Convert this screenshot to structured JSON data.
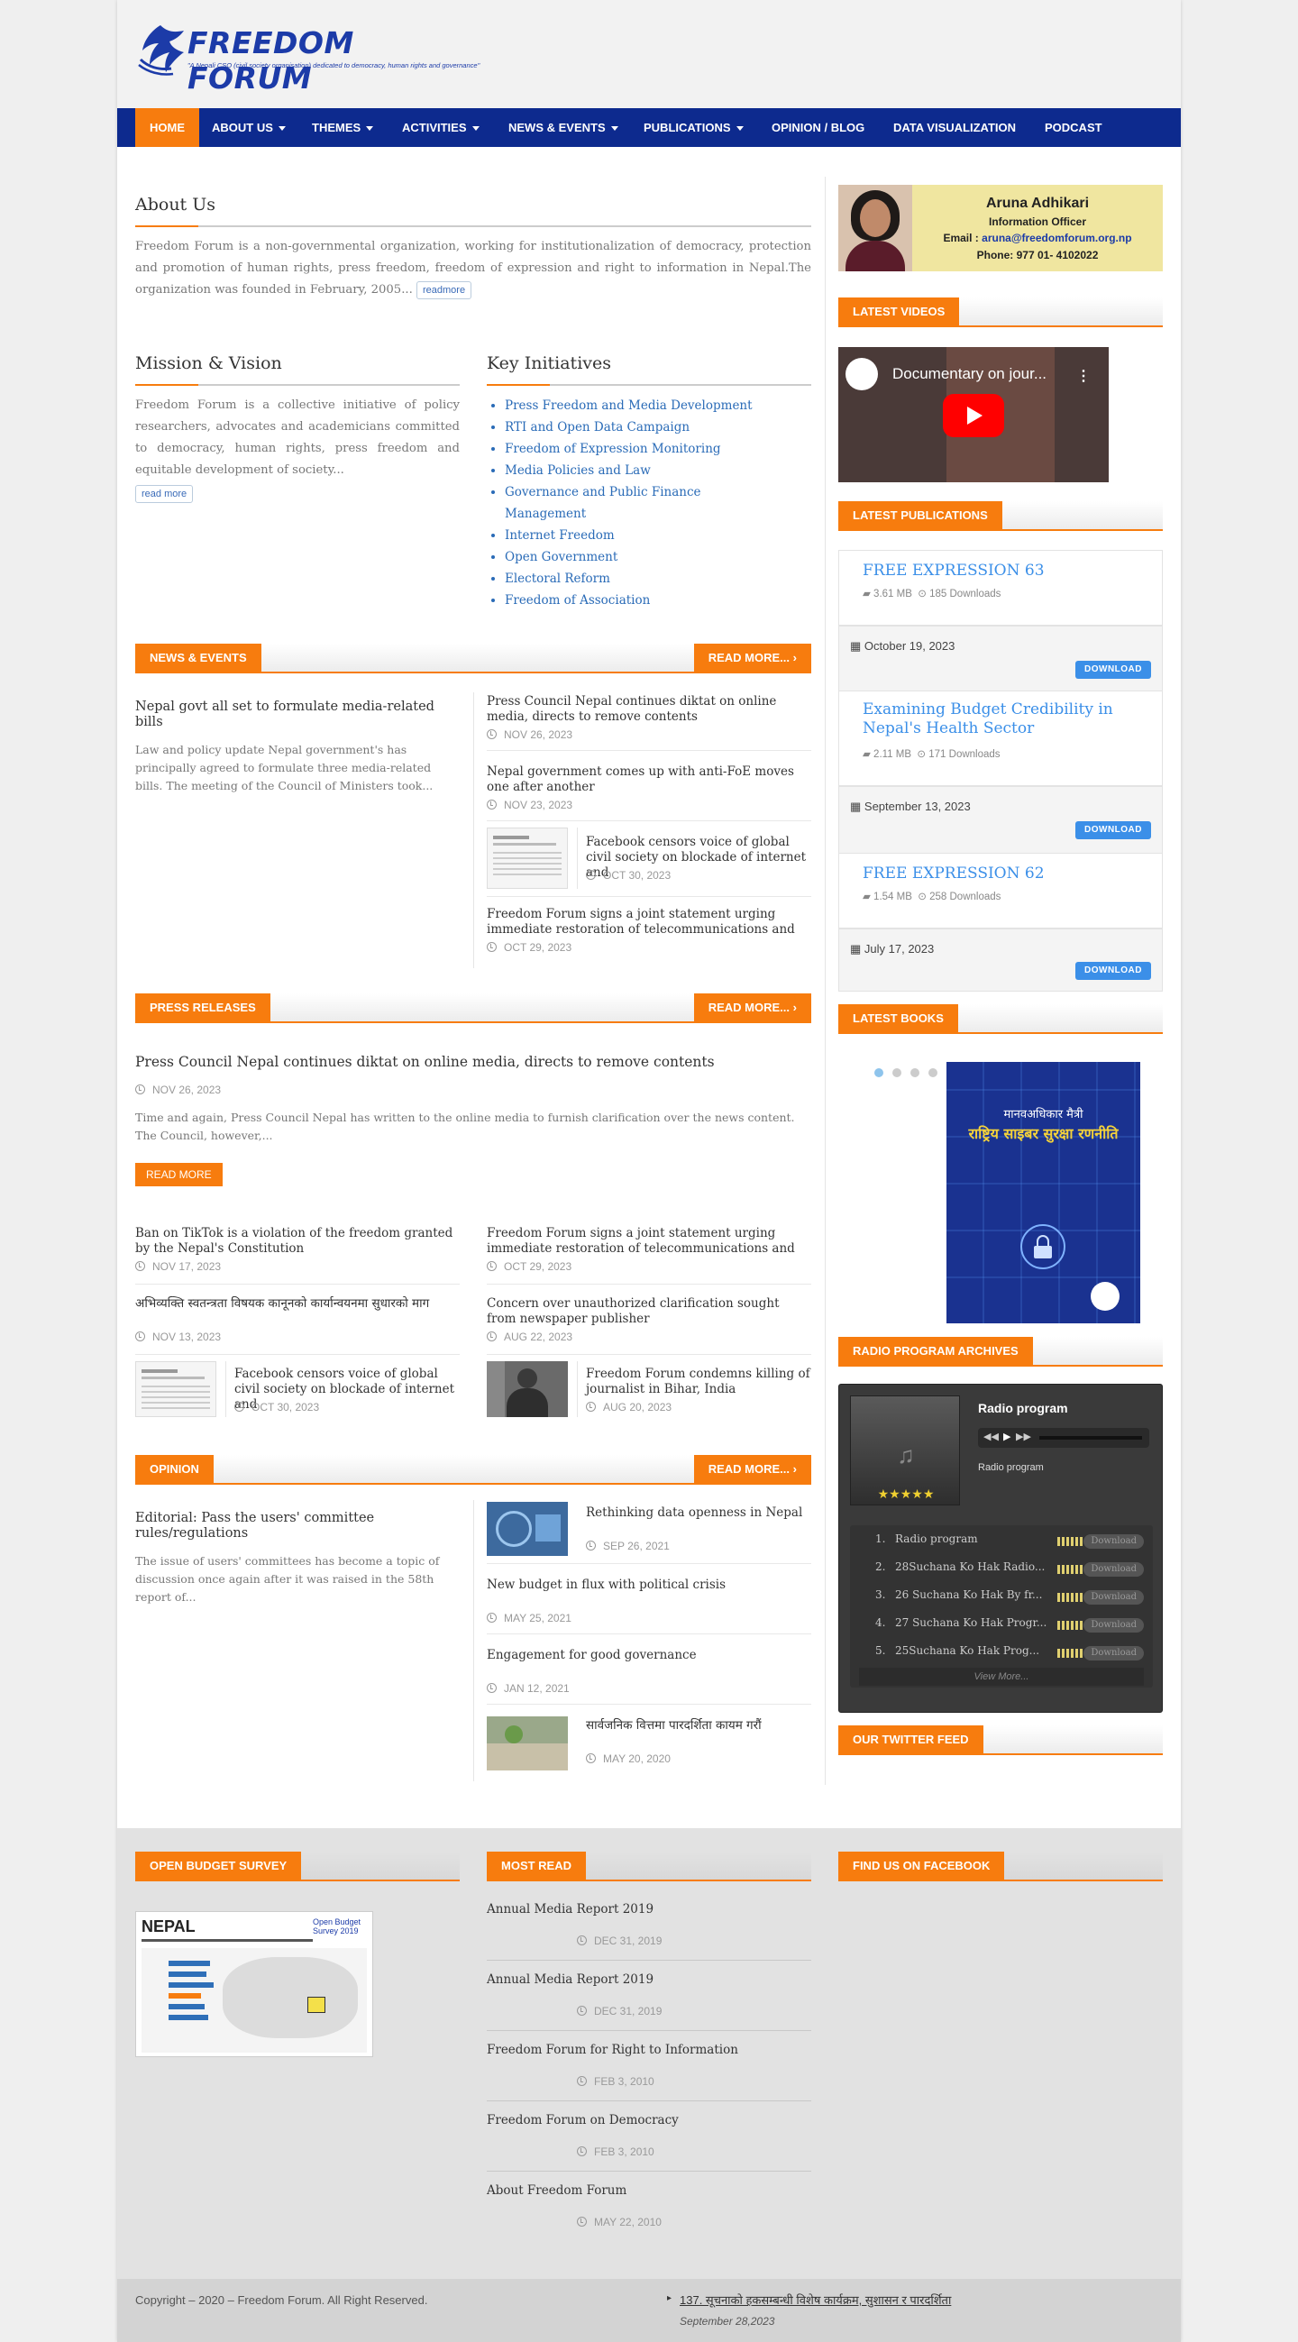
{
  "header": {
    "logo_title": "FREEDOM FORUM",
    "logo_tagline": "\"A Nepali CSO (civil society organisation) dedicated to democracy, human rights and governance\""
  },
  "nav": {
    "items": [
      "HOME",
      "ABOUT US",
      "THEMES",
      "ACTIVITIES",
      "NEWS & EVENTS",
      "PUBLICATIONS",
      "OPINION / BLOG",
      "DATA VISUALIZATION",
      "PODCAST"
    ]
  },
  "about": {
    "heading": "About Us",
    "text": "Freedom Forum is a non-governmental organization, working for institutionalization of democracy, protection and promotion of human rights, press freedom, freedom of expression and right to information in Nepal.The organization was founded in February, 2005...",
    "readmore": "readmore"
  },
  "mission": {
    "heading": "Mission & Vision",
    "text": "Freedom Forum is a collective initiative of policy researchers, advocates and academicians committed to democracy, human rights, press freedom and equitable development of society...",
    "readmore": "read more"
  },
  "initiatives": {
    "heading": "Key Initiatives",
    "items": [
      "Press Freedom and Media Development",
      "RTI and Open Data Campaign",
      "Freedom of Expression Monitoring",
      "Media Policies and Law",
      "Governance and Public Finance Management",
      "Internet Freedom",
      "Open Government",
      "Electoral Reform",
      "Freedom of Association"
    ]
  },
  "news": {
    "label": "NEWS & EVENTS",
    "more": "READ MORE...",
    "featured": {
      "title": "Nepal govt all set to formulate media-related bills",
      "excerpt": "Law and policy update Nepal government's has principally agreed to formulate three media-related bills. The meeting of the Council of Ministers took..."
    },
    "items": [
      {
        "title": "Press Council Nepal continues diktat on online media, directs to remove contents",
        "date": "NOV 26, 2023"
      },
      {
        "title": "Nepal government comes up with anti-FoE moves one after another",
        "date": "NOV 23, 2023"
      },
      {
        "title": "Facebook censors voice of global civil society on blockade of internet and",
        "date": "OCT 30, 2023"
      },
      {
        "title": "Freedom Forum signs a joint statement urging immediate restoration of telecommunications and",
        "date": "OCT 29, 2023"
      }
    ]
  },
  "press": {
    "label": "PRESS RELEASES",
    "more": "READ MORE...",
    "featured": {
      "title": "Press Council Nepal continues diktat on online media, directs to remove contents",
      "date": "NOV 26, 2023",
      "excerpt": "Time and again, Press Council Nepal has written to the online media to furnish clarification over the news content. The Council, however,...",
      "button": "READ MORE"
    },
    "items": [
      {
        "title": "Ban on TikTok is a violation of the freedom granted by the Nepal's Constitution",
        "date": "NOV 17, 2023"
      },
      {
        "title": "Freedom Forum signs a joint statement urging immediate restoration of telecommunications and",
        "date": "OCT 29, 2023"
      },
      {
        "title": "अभिव्यक्ति स्वतन्त्रता विषयक कानूनको कार्यान्वयनमा सुधारको माग",
        "date": "NOV 13, 2023"
      },
      {
        "title": "Concern over unauthorized clarification sought from newspaper publisher",
        "date": "AUG 22, 2023"
      },
      {
        "title": "Facebook censors voice of global civil society on blockade of internet and",
        "date": "OCT 30, 2023"
      },
      {
        "title": "Freedom Forum condemns killing of journalist in Bihar, India",
        "date": "AUG 20, 2023"
      }
    ]
  },
  "opinion": {
    "label": "OPINION",
    "more": "READ MORE...",
    "featured": {
      "title": "Editorial: Pass the users' committee rules/regulations",
      "excerpt": "The issue of users' committees has become a topic of discussion once again after it was raised in the 58th report of..."
    },
    "items": [
      {
        "title": "Rethinking data openness in Nepal",
        "date": "SEP 26, 2021"
      },
      {
        "title": "New budget in flux with political crisis",
        "date": "MAY 25, 2021"
      },
      {
        "title": "Engagement for good governance",
        "date": "JAN 12, 2021"
      },
      {
        "title": "सार्वजनिक वित्तमा पारदर्शिता कायम गरौं",
        "date": "MAY 20, 2020"
      }
    ]
  },
  "sidebar": {
    "contact": {
      "name": "Aruna Adhikari",
      "role": "Information Officer",
      "email_label": "Email : ",
      "email": "aruna@freedomforum.org.np",
      "phone": "Phone: 977 01- 4102022"
    },
    "videos_label": "LATEST VIDEOS",
    "video_title": "Documentary on jour...",
    "pubs_label": "LATEST PUBLICATIONS",
    "publications": [
      {
        "title": "FREE EXPRESSION 63",
        "size": "3.61 MB",
        "downloads": "185 Downloads",
        "date": "October 19, 2023"
      },
      {
        "title": "Examining Budget Credibility in Nepal's Health Sector",
        "size": "2.11 MB",
        "downloads": "171 Downloads",
        "date": "September 13, 2023"
      },
      {
        "title": "FREE EXPRESSION 62",
        "size": "1.54 MB",
        "downloads": "258 Downloads",
        "date": "July 17, 2023"
      }
    ],
    "download_label": "DOWNLOAD",
    "books_label": "LATEST BOOKS",
    "book_line1": "मानवअधिकार मैत्री",
    "book_line2": "राष्ट्रिय साइबर सुरक्षा रणनीति",
    "radio_label": "RADIO PROGRAM ARCHIVES",
    "radio": {
      "title": "Radio program",
      "subtitle": "Radio program",
      "stars": "★★★★★",
      "tracks": [
        {
          "num": "1.",
          "name": "Radio program"
        },
        {
          "num": "2.",
          "name": "28Suchana Ko Hak Radio..."
        },
        {
          "num": "3.",
          "name": "26 Suchana Ko Hak By fr..."
        },
        {
          "num": "4.",
          "name": "27 Suchana Ko Hak Progr..."
        },
        {
          "num": "5.",
          "name": "25Suchana Ko Hak Prog..."
        }
      ],
      "download": "Download",
      "view_more": "View More..."
    },
    "twitter_label": "OUR TWITTER FEED"
  },
  "footer": {
    "budget_label": "OPEN BUDGET SURVEY",
    "budget_country": "NEPAL",
    "budget_badge": "Open Budget Survey 2019",
    "most_read_label": "MOST READ",
    "most_read": [
      {
        "title": "Annual Media Report 2019",
        "date": "DEC 31, 2019"
      },
      {
        "title": "Annual Media Report 2019",
        "date": "DEC 31, 2019"
      },
      {
        "title": "Freedom Forum for Right to Information",
        "date": "FEB 3, 2010"
      },
      {
        "title": "Freedom Forum on Democracy",
        "date": "FEB 3, 2010"
      },
      {
        "title": "About Freedom Forum",
        "date": "MAY 22, 2010"
      }
    ],
    "facebook_label": "FIND US ON FACEBOOK",
    "copyright": "Copyright – 2020 – Freedom Forum. All Right Reserved.",
    "ticker_title": "137. सूचनाको हकसम्बन्धी विशेष कार्यक्रम, सुशासन र पारदर्शिता",
    "ticker_date": "September 28,2023"
  },
  "colors": {
    "accent": "#f77c0e",
    "nav": "#0d2a8e",
    "link": "#2a6bb7",
    "pub": "#3b8fe8"
  }
}
